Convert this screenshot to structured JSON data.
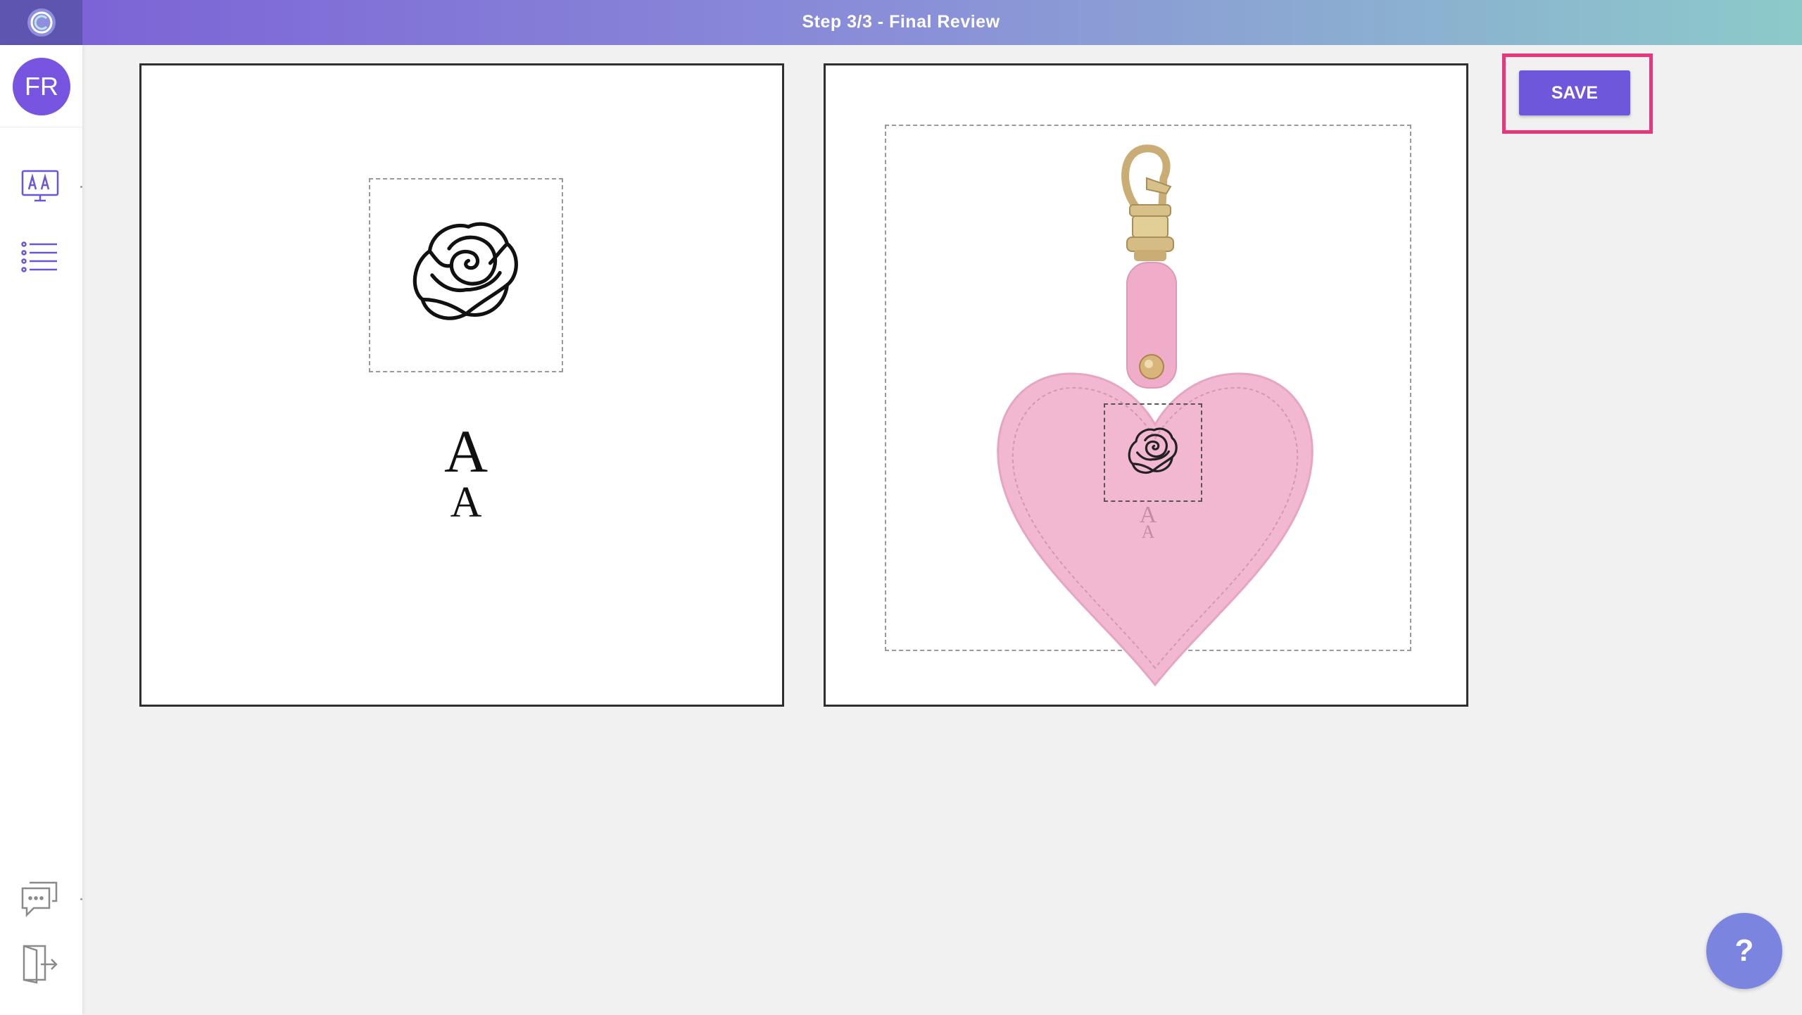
{
  "header": {
    "title": "Step 3/3 - Final Review"
  },
  "user": {
    "initials": "FR"
  },
  "design": {
    "top_letter": "A",
    "bottom_letter": "A"
  },
  "preview": {
    "top_letter": "A",
    "bottom_letter": "A"
  },
  "actions": {
    "save_label": "SAVE",
    "help_label": "?"
  },
  "colors": {
    "accent": "#6f57dc",
    "highlight": "#e8367d",
    "help": "#7b85e0",
    "heart": "#f2b8d2"
  },
  "icons": [
    "app-logo-icon",
    "design-editor-icon",
    "list-icon",
    "chat-icon",
    "exit-icon",
    "rose-icon"
  ]
}
